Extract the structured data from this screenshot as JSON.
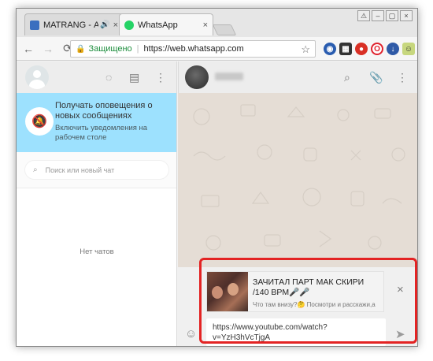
{
  "browser": {
    "tabs": [
      {
        "title": "MATRANG - Акула",
        "favicon_color": "#3b6fbf",
        "audio_icon": "speaker-icon",
        "close": "×"
      },
      {
        "title": "WhatsApp",
        "favicon_color": "#25d366",
        "close": "×"
      }
    ],
    "window_controls": [
      "⚠",
      "–",
      "▢",
      "×"
    ],
    "nav": {
      "back": "←",
      "forward": "→",
      "reload": "C"
    },
    "omnibox": {
      "secure_label": "Защищено",
      "separator": "|",
      "url": "https://web.whatsapp.com",
      "bookmark_icon": "☆"
    },
    "extensions": [
      {
        "name": "globe-extension-icon",
        "color": "#2a5db0",
        "glyph": "●"
      },
      {
        "name": "cart-extension-icon",
        "color": "#333333",
        "glyph": "▦"
      },
      {
        "name": "pin-extension-icon",
        "color": "#d93025",
        "glyph": "●"
      },
      {
        "name": "opera-extension-icon",
        "color": "#e0222d",
        "glyph": "O"
      },
      {
        "name": "download-extension-icon",
        "color": "#2f5aa7",
        "glyph": "●"
      },
      {
        "name": "translate-extension-icon",
        "color": "#6b8a2a",
        "glyph": "☺"
      },
      {
        "name": "menu-icon",
        "color": "#666666",
        "glyph": "⋮"
      }
    ]
  },
  "whatsapp": {
    "left": {
      "header_icons": [
        "status-icon",
        "chat-icon",
        "menu-icon"
      ],
      "notification": {
        "title": "Получать оповещения о новых сообщениях",
        "subtitle": "Включить уведомления на рабочем столе"
      },
      "search": {
        "placeholder": "Поиск или новый чат"
      },
      "empty_label": "Нет чатов"
    },
    "chat": {
      "header_icons": [
        "search-icon",
        "paperclip-icon",
        "menu-icon"
      ],
      "preview": {
        "title": "ЗАЧИТАЛ ПАРТ МАК СКИРИ /140 BPM🎤🎤",
        "description": "Что там внизу?🤔 Посмотри и расскажи,а"
      },
      "close_label": "×",
      "message_text": "https://www.youtube.com/watch?v=YzH3hVcTjgA",
      "send_label": "➤"
    }
  },
  "colors": {
    "accent_highlight": "#e32323",
    "notification_bg": "#9de1fe",
    "chat_bg": "#e5ddd5"
  }
}
